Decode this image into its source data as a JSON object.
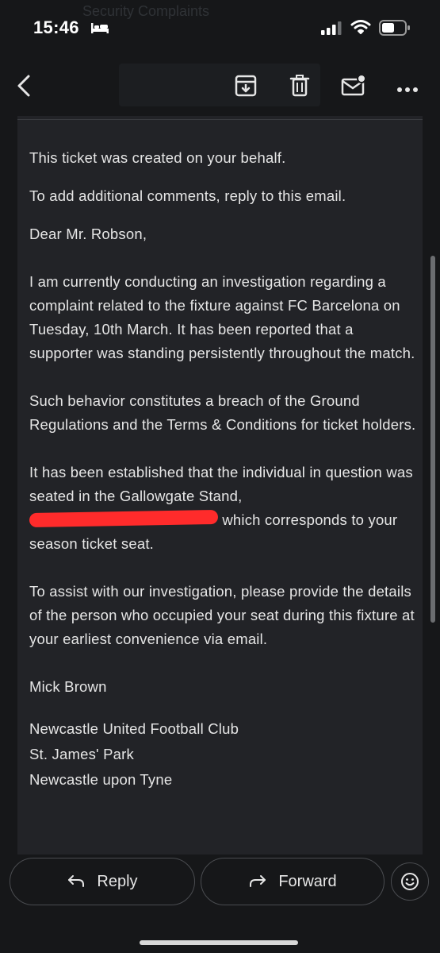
{
  "status_bar": {
    "time": "15:46",
    "ghost_subject": "Security Complaints",
    "icons": [
      "bed-icon",
      "signal-icon",
      "wifi-icon",
      "battery-icon"
    ]
  },
  "toolbar": {
    "icons": [
      "back-icon",
      "archive-icon",
      "trash-icon",
      "mark-unread-icon",
      "more-icon"
    ]
  },
  "email": {
    "intro1": "This ticket was created on your behalf.",
    "intro2": "To add additional comments, reply to this email.",
    "greeting": "Dear Mr. Robson,",
    "para1": "I am currently conducting an investigation regarding a complaint related to the fixture against FC Barcelona on Tuesday, 10th March. It has been reported that a supporter was standing persistently throughout the match.",
    "para2": "Such behavior constitutes a breach of the Ground Regulations and the Terms & Conditions for ticket holders.",
    "para3_start": "It has been established that the individual in question was seated in the Gallowgate Stand,",
    "para3_end": "which corresponds to your season ticket seat.",
    "para4": "To assist with our investigation, please provide the details of the person who occupied your seat during this fixture at your earliest convenience via email.",
    "signature_name": "Mick Brown",
    "address1": "Newcastle United Football Club",
    "address2": "St. James' Park",
    "address3": "Newcastle upon Tyne"
  },
  "actions": {
    "reply_label": "Reply",
    "forward_label": "Forward"
  },
  "colors": {
    "background": "#161719",
    "card": "#222327",
    "text": "#e6e6e6",
    "redaction": "#ff2b2b"
  }
}
